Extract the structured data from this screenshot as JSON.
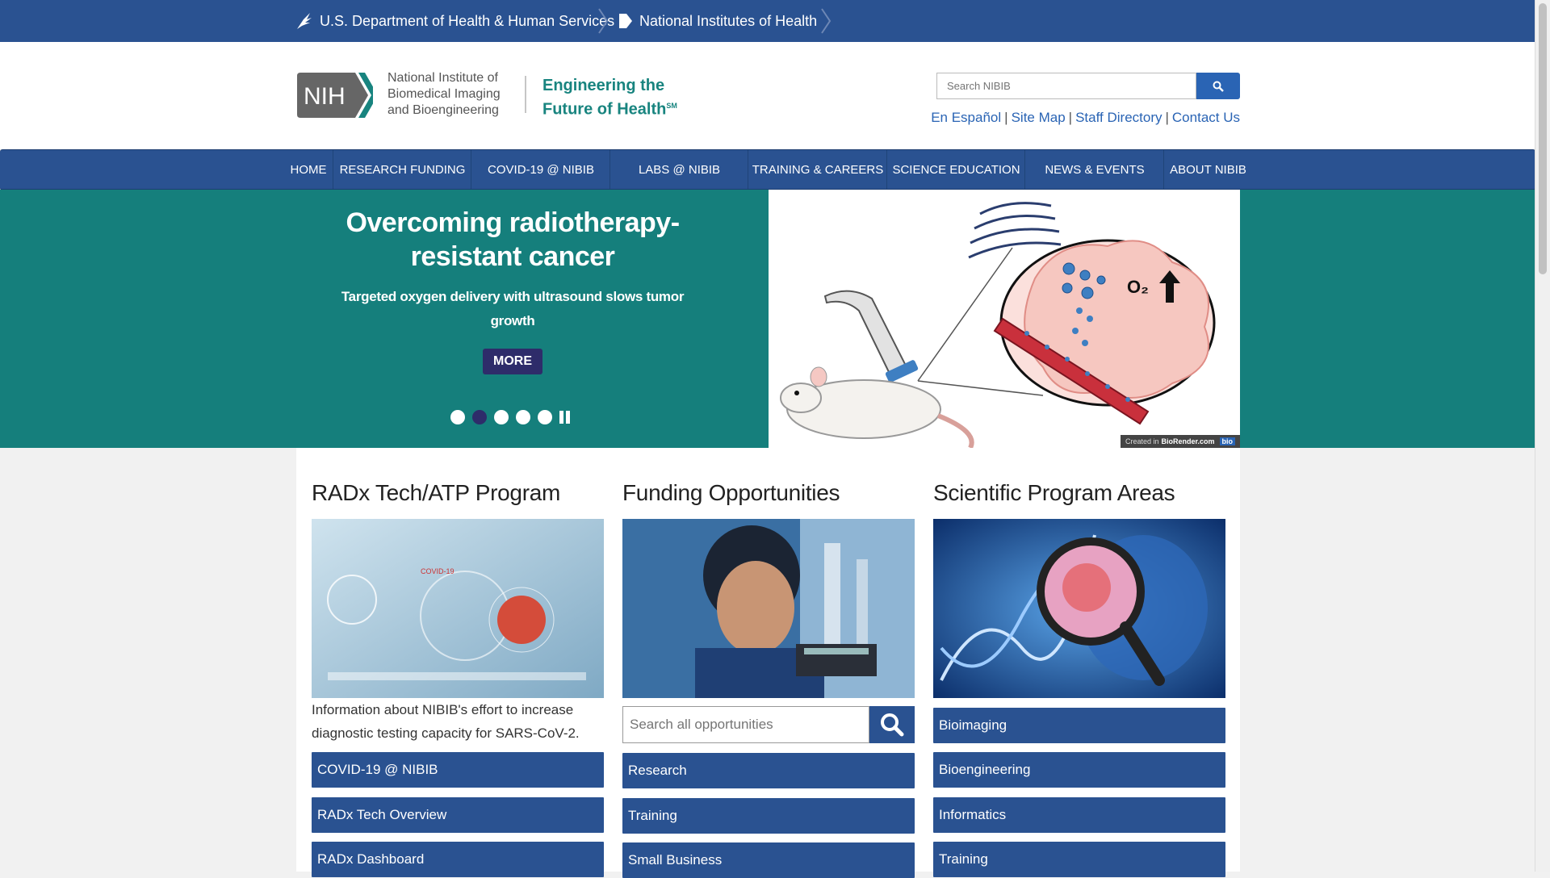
{
  "fedbar": {
    "hhs": "U.S. Department of Health & Human Services",
    "nih": "National Institutes of Health"
  },
  "header": {
    "logo_text": "NIH",
    "institute_line1": "National Institute of",
    "institute_line2": "Biomedical Imaging",
    "institute_line3": "and Bioengineering",
    "tagline_line1": "Engineering the",
    "tagline_line2": "Future of Health",
    "tagline_mark": "SM",
    "search_placeholder": "Search NIBIB",
    "links": [
      "En Español",
      "Site Map",
      "Staff Directory",
      "Contact Us"
    ]
  },
  "nav": [
    "Home",
    "Research Funding",
    "COVID-19 @ NIBIB",
    "Labs @ NIBIB",
    "Training & Careers",
    "Science Education",
    "News & Events",
    "About NIBIB"
  ],
  "hero": {
    "title": "Overcoming radiotherapy-resistant cancer",
    "subtitle": "Targeted oxygen delivery with ultrasound slows tumor growth",
    "more": "MORE",
    "slides": 5,
    "active_slide": 2,
    "image_label": "O₂",
    "credit_prefix": "Created in",
    "credit_site": "BioRender.com",
    "credit_tag": "bio"
  },
  "columns": {
    "radx": {
      "title": "RADx Tech/ATP Program",
      "description": "Information about NIBIB's effort to increase diagnostic testing capacity for SARS-CoV-2.",
      "image_label": "COVID-19",
      "links": [
        "COVID-19 @ NIBIB",
        "RADx Tech Overview",
        "RADx Dashboard"
      ]
    },
    "funding": {
      "title": "Funding Opportunities",
      "search_placeholder": "Search all opportunities",
      "links": [
        "Research",
        "Training",
        "Small Business"
      ]
    },
    "programs": {
      "title": "Scientific Program Areas",
      "links": [
        "Bioimaging",
        "Bioengineering",
        "Informatics",
        "Training"
      ]
    }
  },
  "colors": {
    "federal_blue": "#2a5291",
    "teal": "#157f7c",
    "more_button": "#2e2c6a",
    "link_blue": "#2a64b4"
  }
}
